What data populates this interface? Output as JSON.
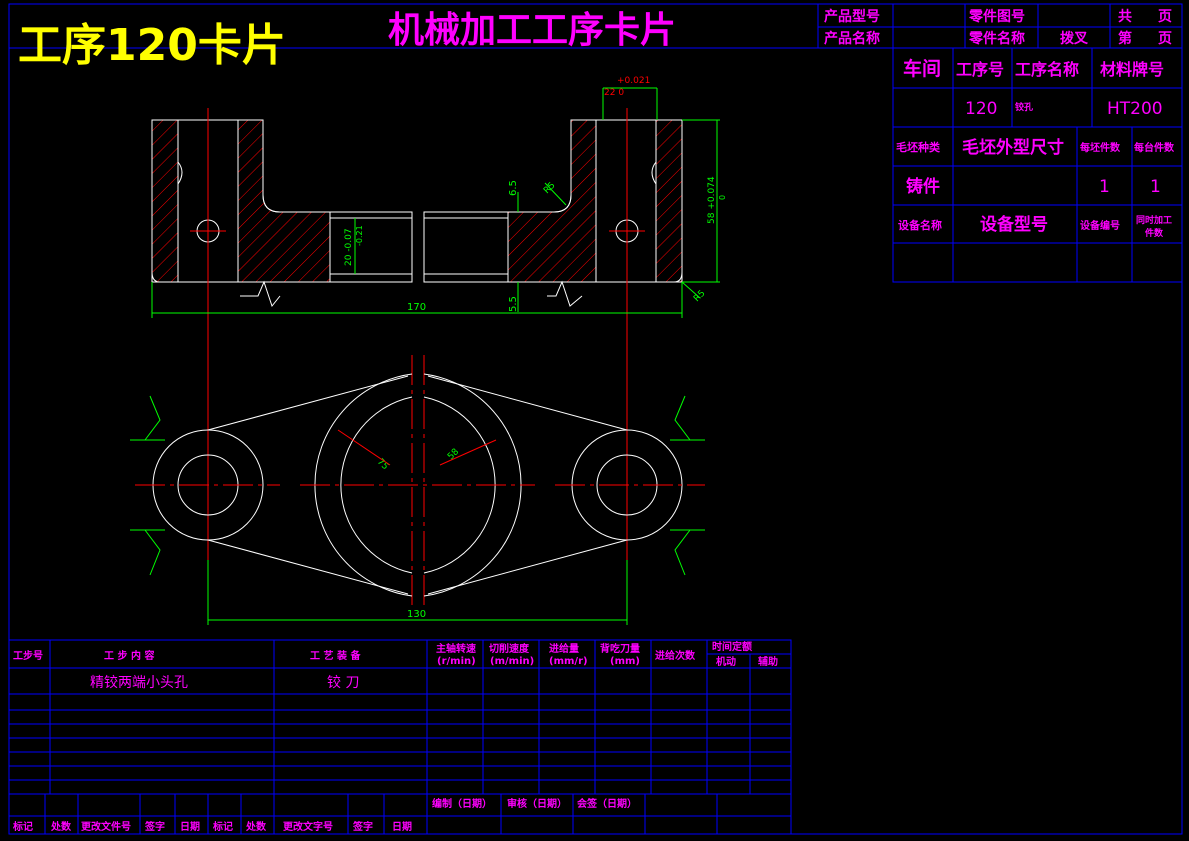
{
  "title_main": "工序120卡片",
  "title_sub": "机械加工工序卡片",
  "header": {
    "product_model_label": "产品型号",
    "product_name_label": "产品名称",
    "part_drawing_no_label": "零件图号",
    "part_name_label": "零件名称",
    "part_name_value": "拨叉",
    "total_label": "共",
    "page_label": "页",
    "sheet_label": "第"
  },
  "info": {
    "workshop_label": "车间",
    "process_no_label": "工序号",
    "process_name_label": "工序名称",
    "material_label": "材料牌号",
    "process_no": "120",
    "process_name": "铰孔",
    "material": "HT200",
    "blank_type_label": "毛坯种类",
    "blank_size_label": "毛坯外型尺寸",
    "per_blank_label": "每坯件数",
    "per_unit_label": "每台件数",
    "blank_type": "铸件",
    "per_blank": "1",
    "per_unit": "1",
    "equip_name_label": "设备名称",
    "equip_model_label": "设备型号",
    "equip_no_label": "设备编号",
    "simultaneous_label_1": "同时加工",
    "simultaneous_label_2": "件数"
  },
  "dims": {
    "tol_top": "+0.021",
    "tol_top_base": "22  0",
    "d_6_5": "6.5",
    "r_85": "R5",
    "d_20": "20 -0.07",
    "d_20b": "-0.21",
    "d_58": "58 +0.074",
    "d_58b": "0",
    "d_170": "170",
    "d_5_5": "5.5",
    "r_5b": "R5",
    "d_75": "75",
    "d_58r": "58",
    "d_130": "130"
  },
  "steps": {
    "col_step_no": "工步号",
    "col_content": "工  步  内  容",
    "col_equipment": "工  艺  装  备",
    "col_spindle_1": "主轴转速",
    "col_spindle_2": "(r/min)",
    "col_cut_speed_1": "切削速度",
    "col_cut_speed_2": "(m/min)",
    "col_feed_1": "进给量",
    "col_feed_2": "(mm/r)",
    "col_depth_1": "背吃刀量",
    "col_depth_2": "(mm)",
    "col_passes": "进给次数",
    "col_time": "时间定额",
    "col_machine": "机动",
    "col_aux": "辅助",
    "row1_content": "精铰两端小头孔",
    "row1_tool": "铰  刀"
  },
  "footer": {
    "compile": "编制（日期）",
    "review": "审核（日期）",
    "countersign": "会签（日期）",
    "marks": [
      "标记",
      "处数",
      "更改文件号",
      "签字",
      "日期",
      "标记",
      "处数",
      "更改文字号",
      "签字",
      "日期"
    ]
  },
  "colors": {
    "frame": "#0000ff",
    "label": "#ff00ff",
    "title_yellow": "#ffff00",
    "outline": "#ffffff",
    "center": "#ff0000",
    "dim": "#00ff00",
    "hatch": "#ff0000"
  }
}
